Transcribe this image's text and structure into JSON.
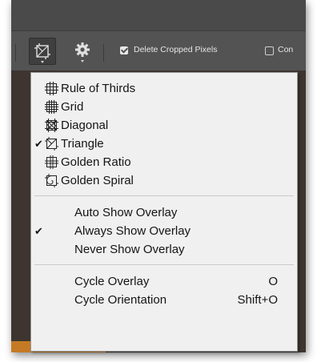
{
  "options_bar": {
    "delete_cropped_label": "Delete Cropped Pixels",
    "delete_cropped_checked": true,
    "content_aware_label": "Con",
    "content_aware_checked": false
  },
  "overlay_menu": {
    "overlay_items": [
      {
        "label": "Rule of Thirds",
        "icon": "rule-of-thirds-icon",
        "checked": false
      },
      {
        "label": "Grid",
        "icon": "grid-icon",
        "checked": false
      },
      {
        "label": "Diagonal",
        "icon": "diagonal-icon",
        "checked": false
      },
      {
        "label": "Triangle",
        "icon": "triangle-icon",
        "checked": true
      },
      {
        "label": "Golden Ratio",
        "icon": "golden-ratio-icon",
        "checked": false
      },
      {
        "label": "Golden Spiral",
        "icon": "golden-spiral-icon",
        "checked": false
      }
    ],
    "show_items": [
      {
        "label": "Auto Show Overlay",
        "checked": false
      },
      {
        "label": "Always Show Overlay",
        "checked": true
      },
      {
        "label": "Never Show Overlay",
        "checked": false
      }
    ],
    "cycle_items": [
      {
        "label": "Cycle Overlay",
        "shortcut": "O"
      },
      {
        "label": "Cycle Orientation",
        "shortcut": "Shift+O"
      }
    ],
    "check_glyph": "✔"
  }
}
